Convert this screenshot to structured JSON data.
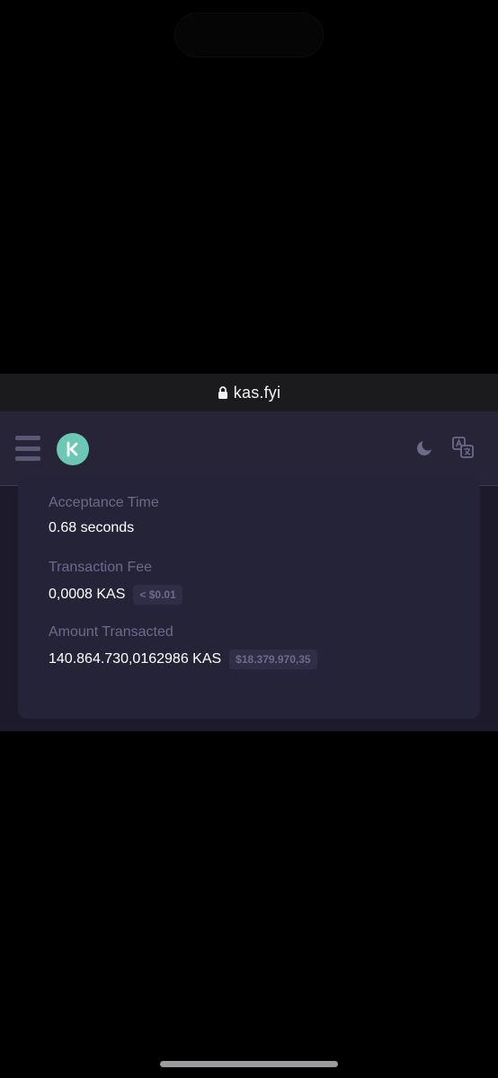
{
  "browser": {
    "url": "kas.fyi",
    "lock_icon": "lock-icon"
  },
  "header": {
    "menu_icon": "hamburger-menu-icon",
    "logo_icon": "kaspa-logo-icon",
    "theme_icon": "moon-icon",
    "language_icon": "translate-icon"
  },
  "transaction": {
    "acceptance_time": {
      "label": "Acceptance Time",
      "value": "0.68 seconds"
    },
    "fee": {
      "label": "Transaction Fee",
      "value": "0,0008 KAS",
      "fiat": "< $0.01"
    },
    "amount": {
      "label": "Amount Transacted",
      "value": "140.864.730,0162986 KAS",
      "fiat": "$18.379.970,35"
    }
  },
  "colors": {
    "background": "#000000",
    "nav": "#272438",
    "card": "#252338",
    "muted_text": "#6d6a8a",
    "accent": "#6cc7b4"
  }
}
